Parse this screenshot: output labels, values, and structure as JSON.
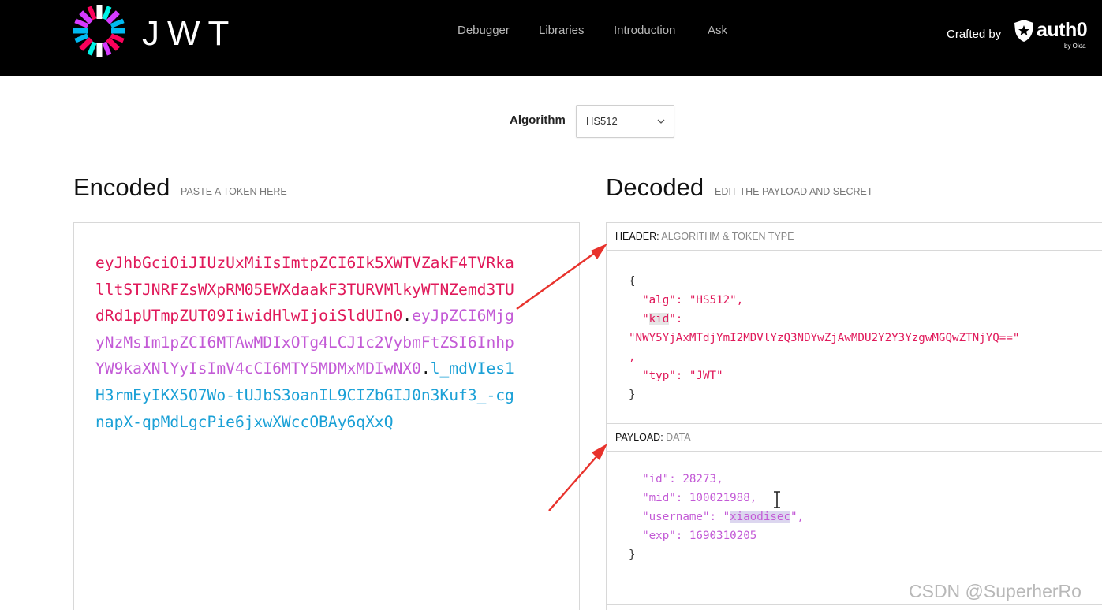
{
  "brand": {
    "logo_text": "JWT",
    "logo_icon": "jwt-starburst-icon"
  },
  "nav": [
    "Debugger",
    "Libraries",
    "Introduction",
    "Ask"
  ],
  "crafted_by": {
    "label": "Crafted by",
    "brand": "auth0",
    "sub": "by Okta"
  },
  "algorithm": {
    "label": "Algorithm",
    "value": "HS512"
  },
  "encoded": {
    "title": "Encoded",
    "subtitle": "PASTE A TOKEN HERE",
    "token": {
      "header": "eyJhbGciOiJIUzUxMiIsImtpZCI6Ik5XWTVZakF4TVRkalltSTJNRFZsWXpRM05EWXdaakF3TURVMlkyWTNZemd3TUdRd1pUTmpZUT09IiwidHlwIjoiSldUIn0",
      "payload": "eyJpZCI6MjgyNzMsIm1pZCI6MTAwMDIxOTg4LCJ1c2VybmFtZSI6InhpYW9kaXNlYyIsImV4cCI6MTY5MDMxMDIwNX0",
      "signature": "l_mdVIes1H3rmEyIKX5O7Wo-tUJbS3oanIL9CIZbGIJ0n3Kuf3_-cgnapX-qpMdLgcPie6jxwXWccOBAy6qXxQ"
    }
  },
  "decoded": {
    "title": "Decoded",
    "subtitle": "EDIT THE PAYLOAD AND SECRET",
    "header_label": "HEADER:",
    "header_sub": "ALGORITHM & TOKEN TYPE",
    "header_json": {
      "alg": "HS512",
      "kid_key": "kid",
      "kid": "NWY5YjAxMTdjYmI2MDVlYzQ3NDYwZjAwMDU2Y2Y3YzgwMGQwZTNjYQ==",
      "typ": "JWT"
    },
    "payload_label": "PAYLOAD:",
    "payload_sub": "DATA",
    "payload_json": {
      "id": "28273",
      "mid": "100021988",
      "username": "xiaodisec",
      "exp": "1690310205"
    }
  },
  "watermark": "CSDN @SuperherRo",
  "colors": {
    "header": "#e0195a",
    "payload": "#c35ad6",
    "signature": "#1aa0d6",
    "arrow": "#e8322c"
  }
}
